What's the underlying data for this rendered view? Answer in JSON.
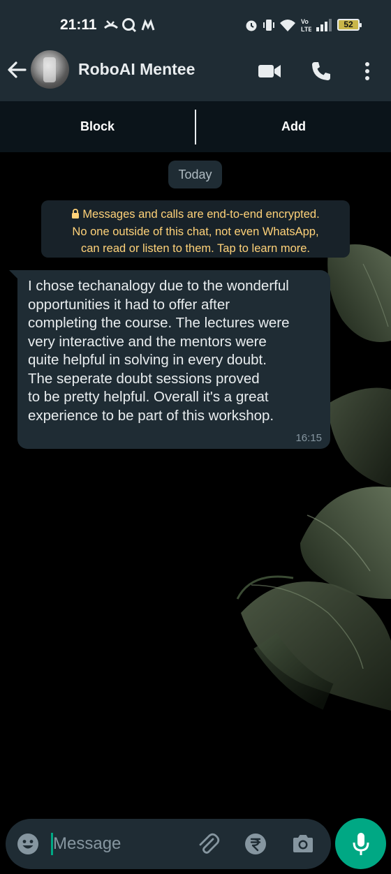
{
  "status_bar": {
    "time": "21:11",
    "battery": "52",
    "icons": [
      "missed-call-icon",
      "search-app-icon",
      "m-app-icon",
      "alarm-icon",
      "vibrate-icon",
      "wifi-icon",
      "volte-icon",
      "signal-icon",
      "battery-icon"
    ]
  },
  "header": {
    "contact_name": "RoboAI Mentee",
    "icons": [
      "back-arrow-icon",
      "video-call-icon",
      "voice-call-icon",
      "more-options-icon"
    ]
  },
  "action_bar": {
    "block_label": "Block",
    "add_label": "Add"
  },
  "chat": {
    "date_chip": "Today",
    "encryption_notice": {
      "line1": "Messages and calls are end-to-end encrypted.",
      "line2": "No one outside of this chat, not even WhatsApp,",
      "line3": "can read or listen to them. Tap to learn more."
    },
    "messages": [
      {
        "lines": [
          "I chose techanalogy due to the wonderful",
          "opportunities it had to offer after",
          "completing the course. The lectures were",
          "very interactive and the mentors were",
          "quite helpful in solving in every doubt.",
          "The seperate doubt sessions proved",
          "to be pretty helpful. Overall it's a great",
          "experience to be part of this workshop."
        ],
        "time": "16:15"
      }
    ]
  },
  "input_bar": {
    "placeholder": "Message",
    "value": "",
    "icons": [
      "emoji-icon",
      "attach-icon",
      "rupee-payment-icon",
      "camera-icon",
      "mic-icon"
    ]
  },
  "colors": {
    "header_bg": "#1f2c34",
    "accent": "#00a884",
    "encryption_text": "#ffd279",
    "chat_bg": "#000000"
  }
}
